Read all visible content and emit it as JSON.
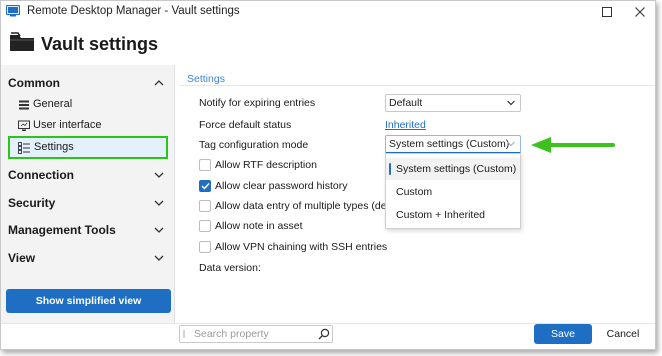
{
  "window": {
    "title": "Remote Desktop Manager - Vault settings",
    "maximize_icon": "maximize-icon",
    "close_icon": "close-icon"
  },
  "header": {
    "title": "Vault settings",
    "icon": "folder-icon"
  },
  "sidebar": {
    "sections": [
      {
        "label": "Common",
        "expanded": true
      },
      {
        "label": "Connection",
        "expanded": false
      },
      {
        "label": "Security",
        "expanded": false
      },
      {
        "label": "Management Tools",
        "expanded": false
      },
      {
        "label": "View",
        "expanded": false
      }
    ],
    "common_items": [
      {
        "label": "General",
        "icon": "list-icon",
        "selected": false
      },
      {
        "label": "User interface",
        "icon": "monitor-icon",
        "selected": false
      },
      {
        "label": "Settings",
        "icon": "settings-list-icon",
        "selected": true
      }
    ],
    "simplified_button": "Show simplified view"
  },
  "main": {
    "group_title": "Settings",
    "notify_label": "Notify for expiring entries",
    "notify_value": "Default",
    "force_status_label": "Force default status",
    "force_status_value": "Inherited",
    "tag_mode_label": "Tag configuration mode",
    "tag_mode_value": "System settings (Custom)",
    "checkboxes": [
      {
        "label": "Allow RTF description",
        "checked": false
      },
      {
        "label": "Allow clear password history",
        "checked": true
      },
      {
        "label": "Allow data entry of multiple types (depre",
        "checked": false
      },
      {
        "label": "Allow note in asset",
        "checked": false
      },
      {
        "label": "Allow VPN chaining with SSH entries",
        "checked": false
      }
    ],
    "data_version_label": "Data version:"
  },
  "dropdown": {
    "options": [
      {
        "label": "System settings (Custom)",
        "selected": true
      },
      {
        "label": "Custom",
        "selected": false
      },
      {
        "label": "Custom + Inherited",
        "selected": false
      }
    ]
  },
  "footer": {
    "search_placeholder": "Search property",
    "save_label": "Save",
    "cancel_label": "Cancel"
  },
  "colors": {
    "accent": "#1e6fc4",
    "highlight_border": "#29c51a",
    "annotation_arrow": "#3cc21e"
  }
}
